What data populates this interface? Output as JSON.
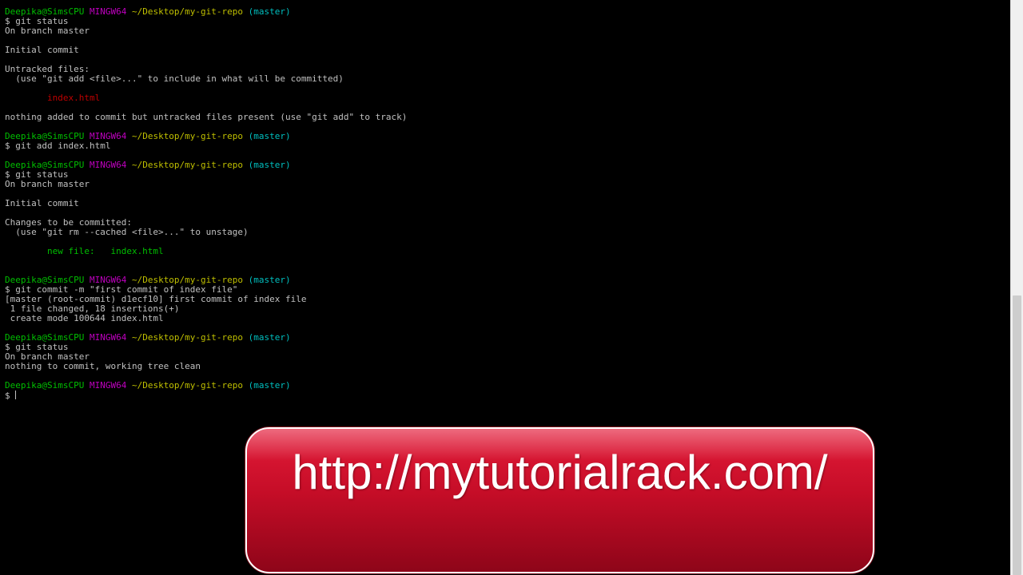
{
  "terminal": {
    "prompt": {
      "user_host": "Deepika@SimsCPU",
      "system": "MINGW64",
      "path": "~/Desktop/my-git-repo",
      "branch": "(master)",
      "symbol": "$"
    },
    "lines": [
      {
        "type": "prompt"
      },
      {
        "type": "cmd",
        "text": "$ git status"
      },
      {
        "type": "text",
        "text": "On branch master"
      },
      {
        "type": "text",
        "text": ""
      },
      {
        "type": "text",
        "text": "Initial commit"
      },
      {
        "type": "text",
        "text": ""
      },
      {
        "type": "text",
        "text": "Untracked files:"
      },
      {
        "type": "text",
        "text": "  (use \"git add <file>...\" to include in what will be committed)"
      },
      {
        "type": "text",
        "text": ""
      },
      {
        "type": "red",
        "text": "        index.html"
      },
      {
        "type": "text",
        "text": ""
      },
      {
        "type": "text",
        "text": "nothing added to commit but untracked files present (use \"git add\" to track)"
      },
      {
        "type": "text",
        "text": ""
      },
      {
        "type": "prompt"
      },
      {
        "type": "cmd",
        "text": "$ git add index.html"
      },
      {
        "type": "text",
        "text": ""
      },
      {
        "type": "prompt"
      },
      {
        "type": "cmd",
        "text": "$ git status"
      },
      {
        "type": "text",
        "text": "On branch master"
      },
      {
        "type": "text",
        "text": ""
      },
      {
        "type": "text",
        "text": "Initial commit"
      },
      {
        "type": "text",
        "text": ""
      },
      {
        "type": "text",
        "text": "Changes to be committed:"
      },
      {
        "type": "text",
        "text": "  (use \"git rm --cached <file>...\" to unstage)"
      },
      {
        "type": "text",
        "text": ""
      },
      {
        "type": "green",
        "text": "        new file:   index.html"
      },
      {
        "type": "text",
        "text": ""
      },
      {
        "type": "text",
        "text": ""
      },
      {
        "type": "prompt"
      },
      {
        "type": "cmd",
        "text": "$ git commit -m \"first commit of index file\""
      },
      {
        "type": "text",
        "text": "[master (root-commit) d1ecf10] first commit of index file"
      },
      {
        "type": "text",
        "text": " 1 file changed, 18 insertions(+)"
      },
      {
        "type": "text",
        "text": " create mode 100644 index.html"
      },
      {
        "type": "text",
        "text": ""
      },
      {
        "type": "prompt"
      },
      {
        "type": "cmd",
        "text": "$ git status"
      },
      {
        "type": "text",
        "text": "On branch master"
      },
      {
        "type": "text",
        "text": "nothing to commit, working tree clean"
      },
      {
        "type": "text",
        "text": ""
      },
      {
        "type": "prompt"
      },
      {
        "type": "input",
        "text": "$ "
      }
    ]
  },
  "banner": {
    "text": "http://mytutorialrack.com/"
  },
  "colors": {
    "background": "#000000",
    "text": "#c0c0c0",
    "user": "#00bf00",
    "mingw": "#bf00bf",
    "path": "#bfbf00",
    "branch": "#00bfbf",
    "untracked": "#bf0000",
    "staged": "#00bf00",
    "banner": "#c50d27"
  }
}
